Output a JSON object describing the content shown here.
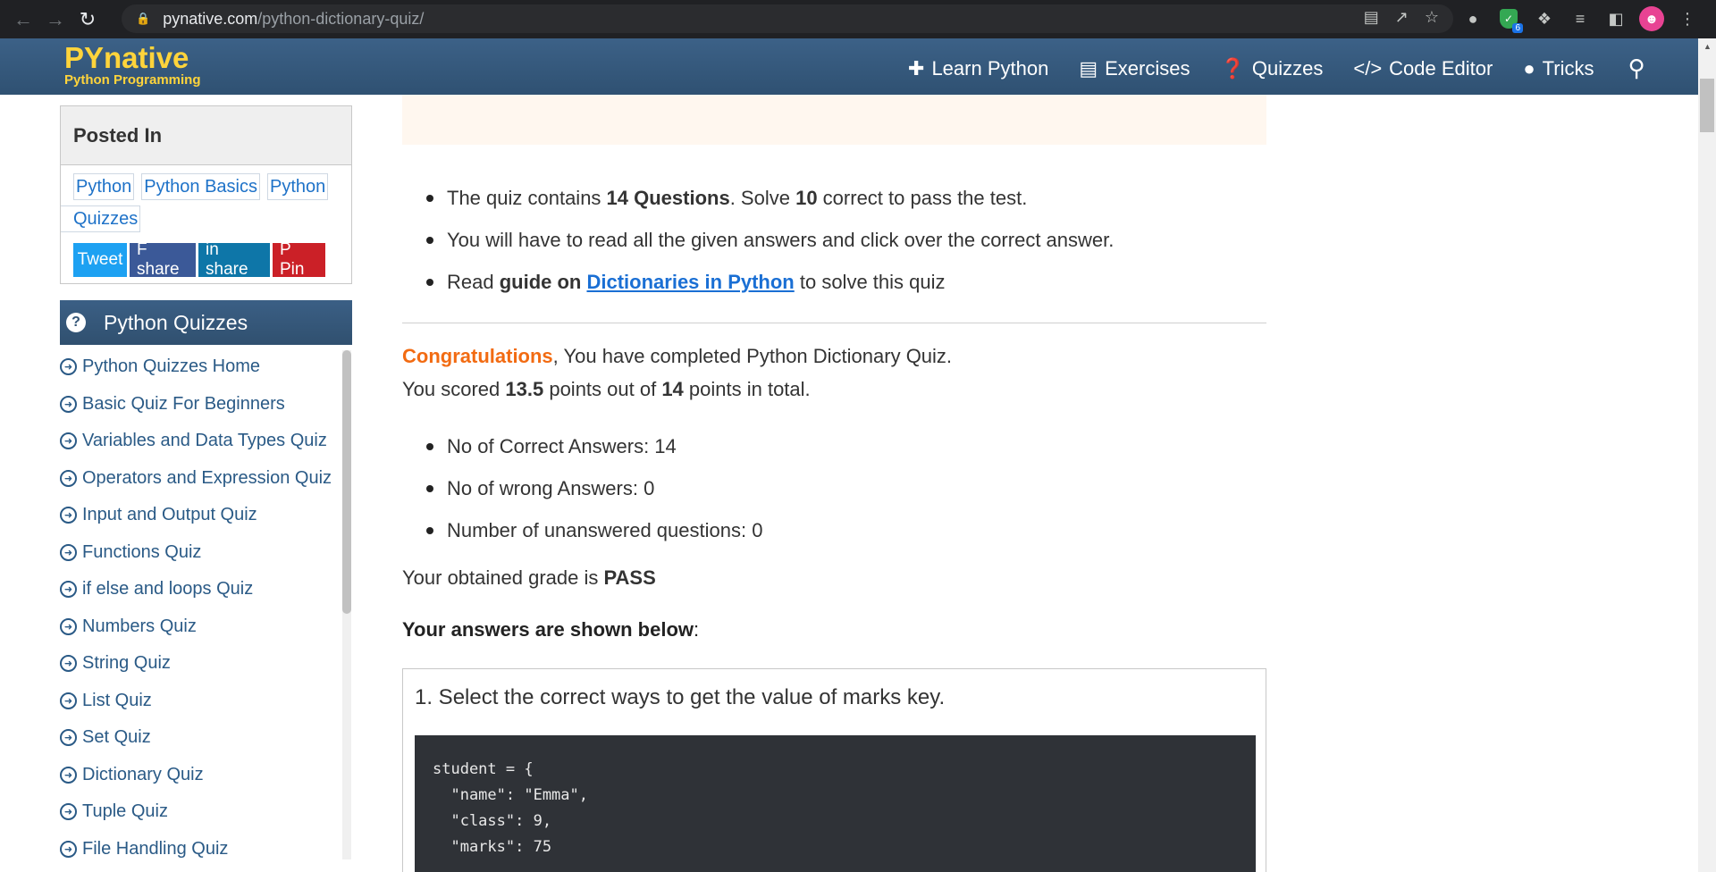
{
  "browser": {
    "url_host": "pynative.com",
    "url_path": "/python-dictionary-quiz/",
    "ext_badge": "6"
  },
  "site": {
    "logo_main": "PYnative",
    "logo_sub": "Python Programming",
    "nav": [
      {
        "label": "Learn Python",
        "icon": "python-icon"
      },
      {
        "label": "Exercises",
        "icon": "laptop-icon"
      },
      {
        "label": "Quizzes",
        "icon": "question-circle-icon"
      },
      {
        "label": "Code Editor",
        "icon": "code-icon"
      },
      {
        "label": "Tricks",
        "icon": "lightbulb-icon"
      }
    ]
  },
  "sidebar": {
    "posted_in_title": "Posted In",
    "tags": [
      "Python",
      "Python Basics",
      "Python",
      "Quizzes"
    ],
    "share": {
      "tweet": "Tweet",
      "facebook": "F  share",
      "linkedin": "in  share",
      "pinterest": "P  Pin"
    },
    "quizzes_title": "Python Quizzes",
    "quizzes": [
      "Python Quizzes Home",
      "Basic Quiz For Beginners",
      "Variables and Data Types Quiz",
      "Operators and Expression Quiz",
      "Input and Output Quiz",
      "Functions Quiz",
      "if else and loops Quiz",
      "Numbers Quiz",
      "String Quiz",
      "List Quiz",
      "Set Quiz",
      "Dictionary Quiz",
      "Tuple Quiz",
      "File Handling Quiz"
    ]
  },
  "main": {
    "intro": {
      "b1_pre": "The quiz contains ",
      "b1_q": "14 Questions",
      "b1_mid": ". Solve ",
      "b1_n": "10",
      "b1_post": " correct to pass the test.",
      "b2": "You will have to read all the given answers and click over the correct answer.",
      "b3_pre": "Read ",
      "b3_bold": "guide on ",
      "b3_link": "Dictionaries in Python",
      "b3_post": " to solve this quiz"
    },
    "result": {
      "congrats": "Congratulations",
      "congrats_rest": ", You have completed Python Dictionary Quiz.",
      "score_pre": "You scored ",
      "score": "13.5",
      "score_mid": " points out of ",
      "total": "14",
      "score_post": " points in total.",
      "correct": "No of Correct Answers: 14",
      "wrong": "No of wrong Answers: 0",
      "unanswered": "Number of unanswered questions: 0",
      "grade_pre": "Your obtained grade is ",
      "grade": "PASS",
      "answers_label": "Your answers are shown below",
      "answers_colon": ":"
    },
    "question1": {
      "text": "1. Select the correct ways to get the value of marks key.",
      "code": "student = {\n  \"name\": \"Emma\",\n  \"class\": 9,\n  \"marks\": 75"
    }
  }
}
